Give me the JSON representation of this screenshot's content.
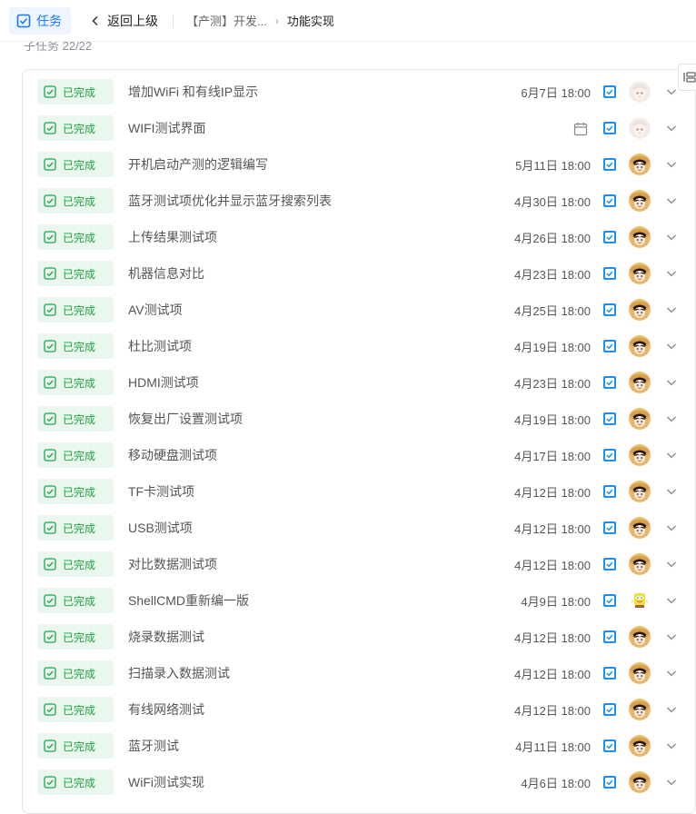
{
  "header": {
    "task_label": "任务",
    "back_label": "返回上级",
    "breadcrumb_parent": "【产测】开发...",
    "breadcrumb_current": "功能实现"
  },
  "subtasks": {
    "heading": "子任务 22/22"
  },
  "colors": {
    "accent": "#1677ff",
    "done_text": "#1fa346",
    "done_bg": "#e9f7ee"
  },
  "tasks": [
    {
      "status": "已完成",
      "title": "增加WiFi 和有线IP显示",
      "due": "6月7日 18:00",
      "avatar": "anime-girl"
    },
    {
      "status": "已完成",
      "title": "WIFI测试界面",
      "due": "",
      "avatar": "anime-girl",
      "calendar_icon": true
    },
    {
      "status": "已完成",
      "title": "开机启动产测的逻辑编写",
      "due": "5月11日 18:00",
      "avatar": "luffy"
    },
    {
      "status": "已完成",
      "title": "蓝牙测试项优化并显示蓝牙搜索列表",
      "due": "4月30日 18:00",
      "avatar": "luffy"
    },
    {
      "status": "已完成",
      "title": "上传结果测试项",
      "due": "4月26日 18:00",
      "avatar": "luffy"
    },
    {
      "status": "已完成",
      "title": "机器信息对比",
      "due": "4月23日 18:00",
      "avatar": "luffy"
    },
    {
      "status": "已完成",
      "title": "AV测试项",
      "due": "4月25日 18:00",
      "avatar": "luffy"
    },
    {
      "status": "已完成",
      "title": "杜比测试项",
      "due": "4月19日 18:00",
      "avatar": "luffy"
    },
    {
      "status": "已完成",
      "title": "HDMI测试项",
      "due": "4月23日 18:00",
      "avatar": "luffy"
    },
    {
      "status": "已完成",
      "title": "恢复出厂设置测试项",
      "due": "4月19日 18:00",
      "avatar": "luffy"
    },
    {
      "status": "已完成",
      "title": "移动硬盘测试项",
      "due": "4月17日 18:00",
      "avatar": "luffy"
    },
    {
      "status": "已完成",
      "title": "TF卡测试项",
      "due": "4月12日 18:00",
      "avatar": "luffy"
    },
    {
      "status": "已完成",
      "title": "USB测试项",
      "due": "4月12日 18:00",
      "avatar": "luffy"
    },
    {
      "status": "已完成",
      "title": "对比数据测试项",
      "due": "4月12日 18:00",
      "avatar": "luffy"
    },
    {
      "status": "已完成",
      "title": "ShellCMD重新编一版",
      "due": "4月9日 18:00",
      "avatar": "sponge"
    },
    {
      "status": "已完成",
      "title": "烧录数据测试",
      "due": "4月12日 18:00",
      "avatar": "luffy"
    },
    {
      "status": "已完成",
      "title": "扫描录入数据测试",
      "due": "4月12日 18:00",
      "avatar": "luffy"
    },
    {
      "status": "已完成",
      "title": "有线网络测试",
      "due": "4月12日 18:00",
      "avatar": "luffy"
    },
    {
      "status": "已完成",
      "title": "蓝牙测试",
      "due": "4月11日 18:00",
      "avatar": "luffy"
    },
    {
      "status": "已完成",
      "title": "WiFi测试实现",
      "due": "4月6日 18:00",
      "avatar": "luffy"
    }
  ]
}
